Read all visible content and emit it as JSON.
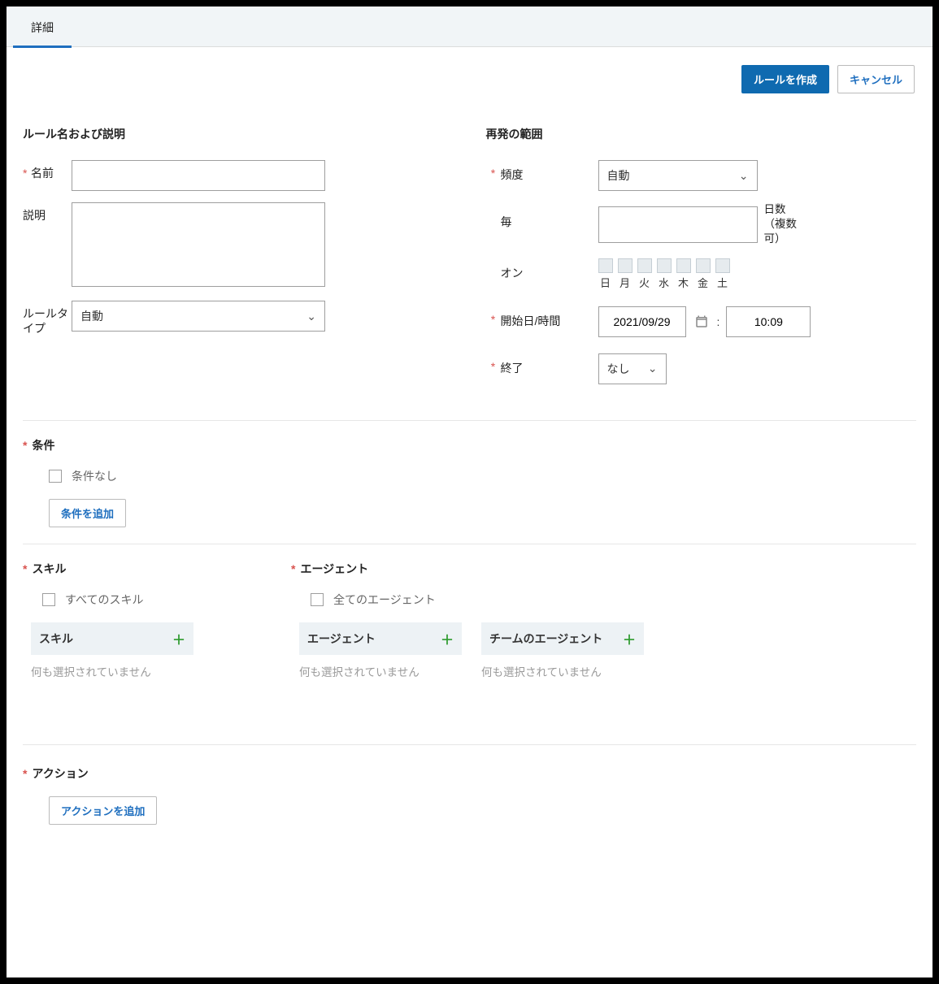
{
  "tab": {
    "detail": "詳細"
  },
  "buttons": {
    "create_rule": "ルールを作成",
    "cancel": "キャンセル",
    "add_condition": "条件を追加",
    "add_action": "アクションを追加"
  },
  "left": {
    "section_title": "ルール名および説明",
    "name_label": "名前",
    "desc_label": "説明",
    "ruletype_label": "ルールタイプ",
    "ruletype_value": "自動"
  },
  "right": {
    "section_title": "再発の範囲",
    "freq_label": "頻度",
    "freq_value": "自動",
    "every_label": "毎",
    "every_suffix": "日数（複数可）",
    "on_label": "オン",
    "days": [
      "日",
      "月",
      "火",
      "水",
      "木",
      "金",
      "土"
    ],
    "start_label": "開始日/時間",
    "start_date": "2021/09/29",
    "start_time_sep": ":",
    "start_time": "10:09",
    "end_label": "終了",
    "end_value": "なし"
  },
  "conditions": {
    "title": "条件",
    "none_label": "条件なし"
  },
  "skills": {
    "title": "スキル",
    "all_label": "すべてのスキル",
    "list_header": "スキル",
    "empty": "何も選択されていません"
  },
  "agents": {
    "title": "エージェント",
    "all_label": "全てのエージェント",
    "list_header": "エージェント",
    "team_header": "チームのエージェント",
    "empty": "何も選択されていません"
  },
  "actions": {
    "title": "アクション"
  }
}
